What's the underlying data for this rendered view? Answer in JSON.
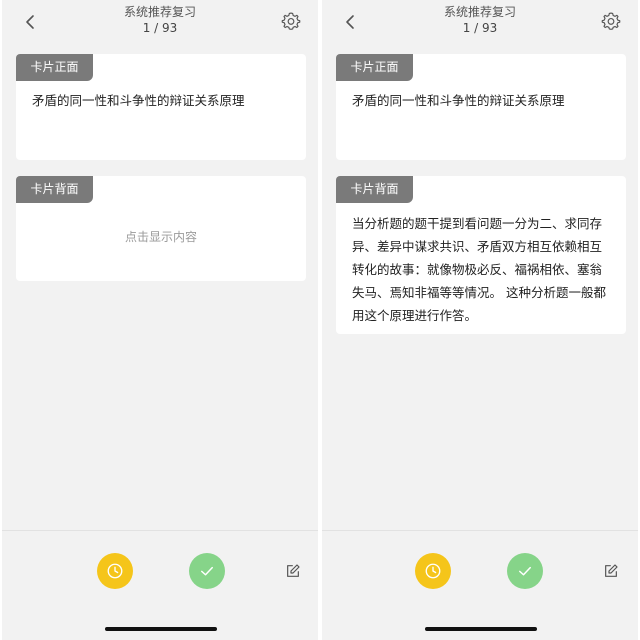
{
  "screens": [
    {
      "header": {
        "title": "系统推荐复习",
        "counter": "1 / 93"
      },
      "front": {
        "tag": "卡片正面",
        "text": "矛盾的同一性和斗争性的辩证关系原理"
      },
      "back": {
        "tag": "卡片背面",
        "placeholder": "点击显示内容"
      }
    },
    {
      "header": {
        "title": "系统推荐复习",
        "counter": "1 / 93"
      },
      "front": {
        "tag": "卡片正面",
        "text": "矛盾的同一性和斗争性的辩证关系原理"
      },
      "back": {
        "tag": "卡片背面",
        "lines": [
          "当分析题的题干提到看问题一分为二、求同存",
          "异、差异中谋求共识、矛盾双方相互依赖相互",
          "转化的故事：就像物极必反、福祸相依、塞翁",
          "失马、焉知非福等等情况。 这种分析题一般都",
          "用这个原理进行作答。"
        ]
      }
    }
  ],
  "icons": {
    "back": "chevron-left-icon",
    "settings": "gear-icon",
    "later": "clock-icon",
    "done": "check-icon",
    "edit": "edit-icon"
  },
  "colors": {
    "tag_bg": "#7a7a7a",
    "later_btn": "#f5c51a",
    "done_btn": "#86d489",
    "screen_bg": "#f2f2f2"
  }
}
